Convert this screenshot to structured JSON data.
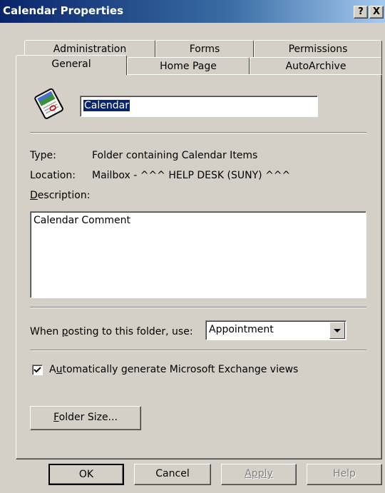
{
  "window": {
    "title": "Calendar Properties",
    "help_label": "?",
    "close_label": "X"
  },
  "tabs": {
    "row_back": [
      {
        "label": "Administration"
      },
      {
        "label": "Forms"
      },
      {
        "label": "Permissions"
      }
    ],
    "row_front": [
      {
        "label": "General",
        "active": true
      },
      {
        "label": "Home Page"
      },
      {
        "label": "AutoArchive"
      }
    ]
  },
  "general": {
    "folder_name": "Calendar",
    "folder_icon": "calendar-folder-icon",
    "type_label": "Type:",
    "type_value": "Folder containing Calendar Items",
    "location_label": "Location:",
    "location_value": "Mailbox - ^^^ HELP DESK (SUNY) ^^^",
    "description_label_rest": "escription:",
    "description_label_mnemonic": "D",
    "description_value": "Calendar Comment",
    "posting_label_pre": "When ",
    "posting_label_mnemonic": "p",
    "posting_label_post": "osting to this folder, use:",
    "posting_selected": "Appointment",
    "auto_views_checked": true,
    "auto_views_pre": "A",
    "auto_views_mnemonic": "u",
    "auto_views_post": "tomatically generate Microsoft Exchange views",
    "folder_size_mnemonic": "F",
    "folder_size_rest": "older Size..."
  },
  "footer": {
    "ok_label": "OK",
    "cancel_label": "Cancel",
    "apply_label": "Apply",
    "help_label": "Help"
  },
  "colors": {
    "title_bar": "#0a246a",
    "face": "#d4d0c8",
    "selection": "#0a246a"
  }
}
